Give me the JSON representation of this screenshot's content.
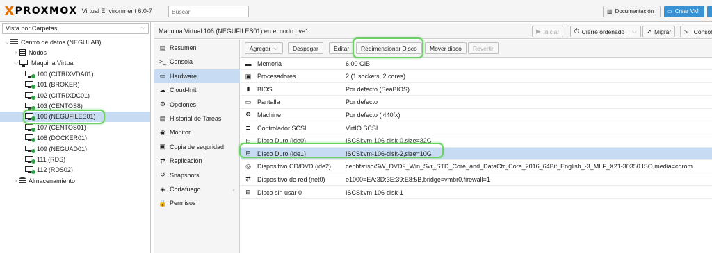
{
  "header": {
    "logo_mark": "X",
    "logo_text": "PROXMOX",
    "version": "Virtual Environment 6.0-7",
    "search_placeholder": "Buscar",
    "doc_button": "Documentación",
    "create_vm_button": "Crear VM"
  },
  "left": {
    "view_select": "Vista por Carpetas",
    "tree": [
      {
        "label": "Centro de datos (NEGULAB)",
        "icon": "datacenter-icon",
        "toggle": "⌵",
        "indent": 0
      },
      {
        "label": "Nodos",
        "icon": "node-icon",
        "toggle": "›",
        "indent": 1
      },
      {
        "label": "Maquina Virtual",
        "icon": "monitor-icon",
        "toggle": "⌵",
        "indent": 1
      },
      {
        "label": "100 (CITRIXVDA01)",
        "icon": "vm-running-icon",
        "indent": 2
      },
      {
        "label": "101 (BROKER)",
        "icon": "vm-running-icon",
        "indent": 2
      },
      {
        "label": "102 (CITRIXDC01)",
        "icon": "vm-running-icon",
        "indent": 2
      },
      {
        "label": "103 (CENTOS8)",
        "icon": "vm-running-icon",
        "indent": 2
      },
      {
        "label": "106 (NEGUFILES01)",
        "icon": "vm-running-icon",
        "indent": 2
      },
      {
        "label": "107 (CENTOS01)",
        "icon": "vm-running-icon",
        "indent": 2
      },
      {
        "label": "108 (DOCKER01)",
        "icon": "vm-running-icon",
        "indent": 2
      },
      {
        "label": "109 (NEGUAD01)",
        "icon": "vm-running-icon",
        "indent": 2
      },
      {
        "label": "111 (RDS)",
        "icon": "vm-running-icon",
        "indent": 2
      },
      {
        "label": "112 (RDS02)",
        "icon": "vm-running-icon",
        "indent": 2
      },
      {
        "label": "Almacenamiento",
        "icon": "storage-icon",
        "toggle": "›",
        "indent": 1
      }
    ]
  },
  "content": {
    "title": "Maquina Virtual 106 (NEGUFILES01) en el nodo pve1",
    "actions": {
      "start": "Iniciar",
      "shutdown": "Cierre ordenado",
      "migrate": "Migrar",
      "console": "Consol"
    }
  },
  "nav": [
    {
      "label": "Resumen",
      "glyph": "▤"
    },
    {
      "label": "Consola",
      "glyph": ">_"
    },
    {
      "label": "Hardware",
      "glyph": "▭"
    },
    {
      "label": "Cloud-Init",
      "glyph": "☁"
    },
    {
      "label": "Opciones",
      "glyph": "⚙"
    },
    {
      "label": "Historial de Tareas",
      "glyph": "▤"
    },
    {
      "label": "Monitor",
      "glyph": "◉"
    },
    {
      "label": "Copia de seguridad",
      "glyph": "▣"
    },
    {
      "label": "Replicación",
      "glyph": "⇄"
    },
    {
      "label": "Snapshots",
      "glyph": "↺"
    },
    {
      "label": "Cortafuego",
      "glyph": "◈",
      "arrow": "›"
    },
    {
      "label": "Permisos",
      "glyph": "🔓"
    }
  ],
  "toolbar": {
    "add": "Agregar",
    "detach": "Despegar",
    "edit": "Editar",
    "resize": "Redimensionar Disco",
    "move": "Mover disco",
    "revert": "Revertir"
  },
  "hardware": [
    {
      "name": "Memoria",
      "value": "6.00 GiB",
      "glyph": "▬"
    },
    {
      "name": "Procesadores",
      "value": "2 (1 sockets, 2 cores)",
      "glyph": "▣"
    },
    {
      "name": "BIOS",
      "value": "Por defecto (SeaBIOS)",
      "glyph": "▮"
    },
    {
      "name": "Pantalla",
      "value": "Por defecto",
      "glyph": "▭"
    },
    {
      "name": "Machine",
      "value": "Por defecto (i440fx)",
      "glyph": "⚙"
    },
    {
      "name": "Controlador SCSI",
      "value": "VirtIO SCSI",
      "glyph": "≣"
    },
    {
      "name": "Disco Duro (ide0)",
      "value": "ISCSI:vm-106-disk-0,size=32G",
      "glyph": "⊟"
    },
    {
      "name": "Disco Duro (ide1)",
      "value": "ISCSI:vm-106-disk-2,size=10G",
      "glyph": "⊟"
    },
    {
      "name": "Dispositivo CD/DVD (ide2)",
      "value": "cephfs:iso/SW_DVD9_Win_Svr_STD_Core_and_DataCtr_Core_2016_64Bit_English_-3_MLF_X21-30350.ISO,media=cdrom",
      "glyph": "◎"
    },
    {
      "name": "Dispositivo de red (net0)",
      "value": "e1000=EA:3D:3E:39:E8:5B,bridge=vmbr0,firewall=1",
      "glyph": "⇄"
    },
    {
      "name": "Disco sin usar 0",
      "value": "ISCSI:vm-106-disk-1",
      "glyph": "⊟"
    }
  ],
  "colors": {
    "accent": "#3892d4",
    "logo": "#e57000",
    "selection": "#c7dcf2",
    "highlight": "#6fcf67",
    "running": "#2ea043"
  }
}
